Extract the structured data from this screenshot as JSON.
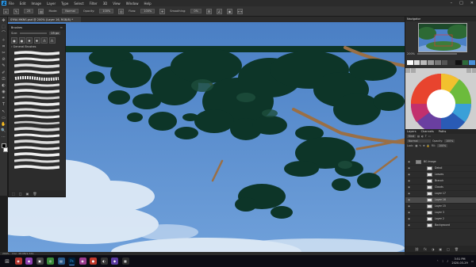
{
  "menubar": {
    "logo": "Ps",
    "items": [
      "File",
      "Edit",
      "Image",
      "Layer",
      "Type",
      "Select",
      "Filter",
      "3D",
      "View",
      "Window",
      "Help"
    ],
    "window_controls": [
      "–",
      "□",
      "✕"
    ]
  },
  "options": {
    "size": "25",
    "mode_label": "Mode:",
    "mode": "Normal",
    "opacity_label": "Opacity:",
    "opacity": "100%",
    "flow_label": "Flow:",
    "flow": "100%",
    "smoothing_label": "Smoothing:",
    "smoothing": "0%"
  },
  "document": {
    "tab_title": "SYNA MKNS.psd @ 200% (Layer 16, RGB/8) *"
  },
  "tools": [
    "✥",
    "⬚",
    "⌒",
    "✧",
    "⌗",
    "✂",
    "⊘",
    "✎",
    "✐",
    "⎚",
    "◐",
    "◉",
    "✒",
    "T",
    "↖",
    "▭",
    "✋",
    "🔍",
    "⋯"
  ],
  "brushes_panel": {
    "title": "Brushes",
    "size_label": "Size:",
    "size_value": "25 px",
    "folder": "› General Brushes",
    "footer_icons": [
      "⬚",
      "□",
      "▣",
      "🗑"
    ]
  },
  "navigator": {
    "tab": "Navigator",
    "zoom": "200%"
  },
  "layers_panel": {
    "tabs": [
      "Layers",
      "Channels",
      "Paths"
    ],
    "kind_label": "Kind",
    "blend_mode": "Normal",
    "opacity_label": "Opacity:",
    "opacity": "100%",
    "lock_label": "Lock:",
    "fill_label": "Fill:",
    "fill": "100%",
    "layers": [
      {
        "name": "BG Image",
        "group": true,
        "selected": false
      },
      {
        "name": "Detail",
        "group": false,
        "selected": false
      },
      {
        "name": "Leaves",
        "group": false,
        "selected": false
      },
      {
        "name": "Branch",
        "group": false,
        "selected": false
      },
      {
        "name": "Clouds",
        "group": false,
        "selected": false
      },
      {
        "name": "Layer 17",
        "group": false,
        "selected": false
      },
      {
        "name": "Layer 16",
        "group": false,
        "selected": true
      },
      {
        "name": "Layer 15",
        "group": false,
        "selected": false
      },
      {
        "name": "Layer 3",
        "group": false,
        "selected": false
      },
      {
        "name": "Layer 2",
        "group": false,
        "selected": false
      },
      {
        "name": "Background",
        "group": false,
        "selected": false
      }
    ],
    "footer_icons": [
      "⛓",
      "fx",
      "◑",
      "▣",
      "□",
      "🗑"
    ]
  },
  "status": {
    "zoom": "200%",
    "doc": "Doc: 48.9M/1.32G"
  },
  "taskbar": {
    "start": "⊞",
    "time": "3:51 PM",
    "date": "2020-03-29"
  },
  "colors": {
    "sky": "#5b8fcf",
    "foliage": "#0d3528",
    "branch": "#9a6f45",
    "ui_dark": "#2f2f2f"
  }
}
